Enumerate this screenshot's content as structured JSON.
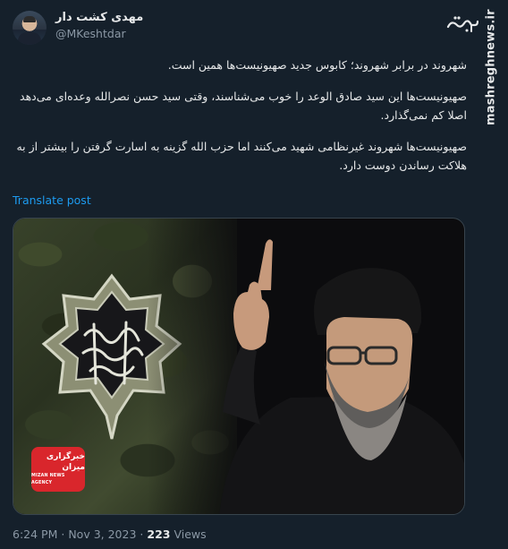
{
  "author": {
    "display_name": "مهدی کشت دار",
    "handle": "@MKeshtdar",
    "avatar_icon": "user-avatar"
  },
  "brand": {
    "logo_name": "mashregh-logo-icon",
    "watermark": "mashreghnews.ir"
  },
  "post": {
    "paragraphs": [
      "شهروند در برابر شهروند؛ کابوس جدید صهیونیست‌ها همین است.",
      "صهیونیست‌ها این سید صادق الوعد را خوب می‌شناسند، وقتی سید حسن نصرالله وعده‌ای می‌دهد اصلا کم نمی‌گذارد.",
      "صهیونیست‌ها شهروند غیرنظامی شهید می‌کنند اما حزب الله گزینه به اسارت گرفتن را بیشتر از به هلاکت رساندن دوست دارد."
    ],
    "translate_label": "Translate post"
  },
  "media": {
    "news_logo_fa": "خبرگزاری میزان",
    "news_logo_en": "MIZAN NEWS AGENCY"
  },
  "meta": {
    "time": "6:24 PM",
    "separator": "·",
    "date": "Nov 3, 2023",
    "views_count": "223",
    "views_label": "Views"
  },
  "colors": {
    "background": "#15202b",
    "link": "#1d9bf0",
    "muted": "#8b98a5",
    "news_red": "#d9262c"
  }
}
